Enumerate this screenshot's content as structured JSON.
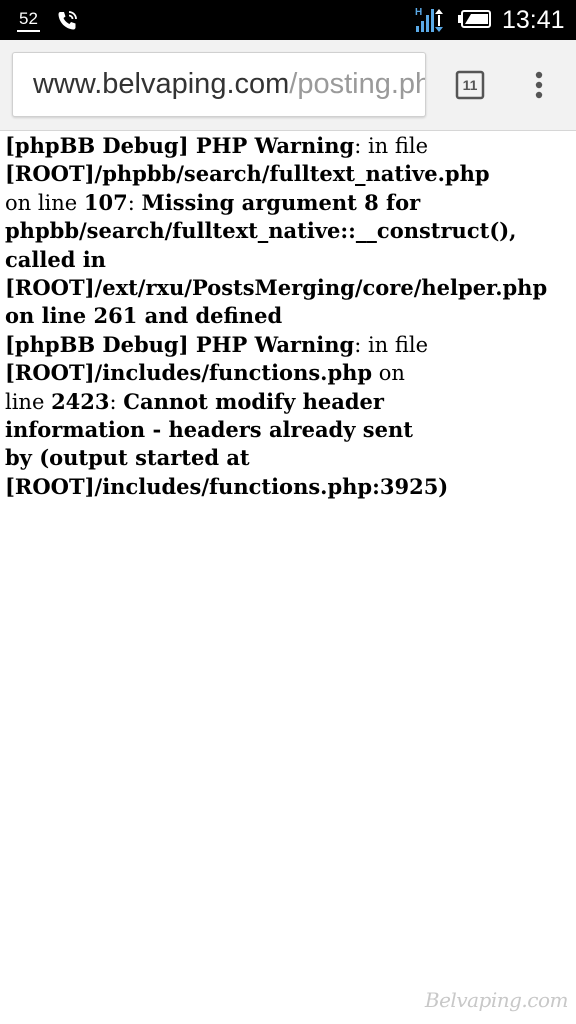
{
  "status_bar": {
    "notification_count": "52",
    "call_icon": "phone-call-icon",
    "signal_icon": "hplus-signal-icon",
    "battery_icon": "battery-icon",
    "time": "13:41",
    "background": "#000000"
  },
  "browser": {
    "url_host": "www.belvaping.com",
    "url_path": "/posting.php",
    "tab_count": "11",
    "tabs_icon": "tabs-icon",
    "menu_icon": "overflow-menu-icon"
  },
  "page": {
    "lines": [
      [
        {
          "text": "[phpBB Debug] PHP Warning",
          "bold": true
        },
        {
          "text": ": in file",
          "bold": false
        }
      ],
      [
        {
          "text": "[ROOT]/phpbb/search/fulltext_native.php",
          "bold": true
        }
      ],
      [
        {
          "text": "on line ",
          "bold": false
        },
        {
          "text": "107",
          "bold": true
        },
        {
          "text": ": ",
          "bold": false
        },
        {
          "text": "Missing argument 8 for",
          "bold": true
        }
      ],
      [
        {
          "text": "phpbb/search/fulltext_native::__construct(),",
          "bold": true
        }
      ],
      [
        {
          "text": "called in",
          "bold": true
        }
      ],
      [
        {
          "text": "[ROOT]/ext/rxu/PostsMerging/core/helper.php",
          "bold": true
        }
      ],
      [
        {
          "text": "on line 261 and defined",
          "bold": true
        }
      ],
      [
        {
          "text": "[phpBB Debug] PHP Warning",
          "bold": true
        },
        {
          "text": ": in file",
          "bold": false
        }
      ],
      [
        {
          "text": "[ROOT]/includes/functions.php",
          "bold": true
        },
        {
          "text": " on",
          "bold": false
        }
      ],
      [
        {
          "text": "line ",
          "bold": false
        },
        {
          "text": "2423",
          "bold": true
        },
        {
          "text": ": ",
          "bold": false
        },
        {
          "text": "Cannot modify header",
          "bold": true
        }
      ],
      [
        {
          "text": "information - headers already sent",
          "bold": true
        }
      ],
      [
        {
          "text": "by (output started at",
          "bold": true
        }
      ],
      [
        {
          "text": "[ROOT]/includes/functions.php:3925)",
          "bold": true
        }
      ]
    ]
  },
  "watermark": {
    "text": "Belvaping.com"
  }
}
